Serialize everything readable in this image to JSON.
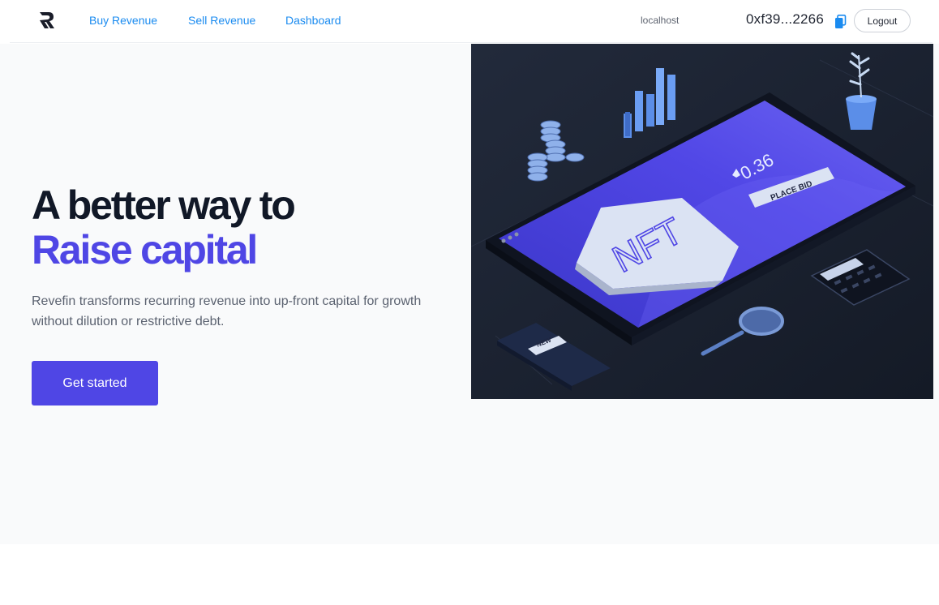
{
  "nav": {
    "links": [
      "Buy Revenue",
      "Sell Revenue",
      "Dashboard"
    ],
    "host": "localhost",
    "wallet_address": "0xf39...2266",
    "logout_label": "Logout"
  },
  "hero": {
    "headline_line1": "A better way to",
    "headline_line2": "Raise capital",
    "description": "Revefin transforms recurring revenue into up-front capital for growth without dilution or restrictive debt.",
    "cta_label": "Get started"
  },
  "illustration": {
    "screen_badge": "NFT",
    "price": "0.36",
    "button_label": "PLACE BID",
    "card_label": "NEW"
  },
  "colors": {
    "accent": "#4f46e5",
    "link": "#1a8bf0",
    "heading": "#111827",
    "illustration_bg": "#1b2130"
  }
}
